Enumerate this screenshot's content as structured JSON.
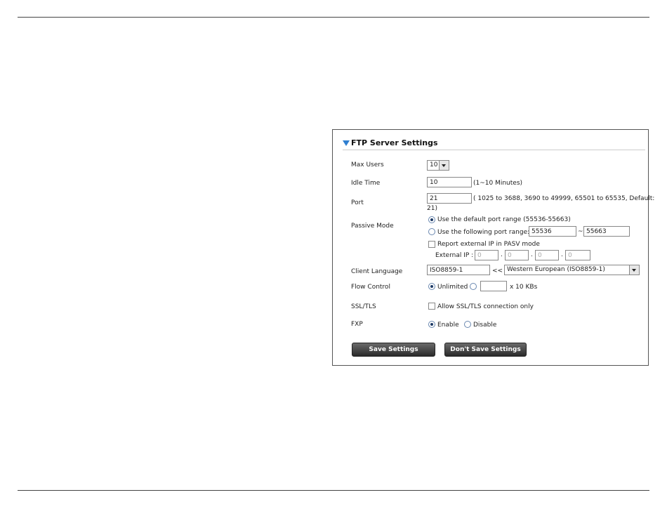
{
  "panel": {
    "title": "FTP Server Settings",
    "max_users": {
      "label": "Max Users",
      "value": "10"
    },
    "idle_time": {
      "label": "Idle Time",
      "value": "10",
      "hint": "(1~10 Minutes)"
    },
    "port": {
      "label": "Port",
      "value": "21",
      "hint_line1": "( 1025 to 3688, 3690 to 49999, 65501 to 65535, Default:",
      "hint_line2": "21)"
    },
    "passive_mode": {
      "label": "Passive Mode",
      "option_default": "Use the default port range (55536-55663)",
      "option_following": "Use the following port range:",
      "range_start": "55536",
      "range_sep": "~",
      "range_end": "55663",
      "report_external": "Report external IP in PASV mode",
      "external_ip_label": "External IP :",
      "ip_octets": [
        "0",
        "0",
        "0",
        "0"
      ],
      "dot": "."
    },
    "client_language": {
      "label": "Client Language",
      "code": "ISO8859-1",
      "arrows": "<<",
      "selected": "Western European (ISO8859-1)"
    },
    "flow_control": {
      "label": "Flow Control",
      "unlimited": "Unlimited",
      "unit": "x 10 KBs"
    },
    "ssl_tls": {
      "label": "SSL/TLS",
      "option": "Allow SSL/TLS connection only"
    },
    "fxp": {
      "label": "FXP",
      "enable": "Enable",
      "disable": "Disable"
    },
    "buttons": {
      "save": "Save Settings",
      "dont_save": "Don't Save Settings"
    }
  }
}
